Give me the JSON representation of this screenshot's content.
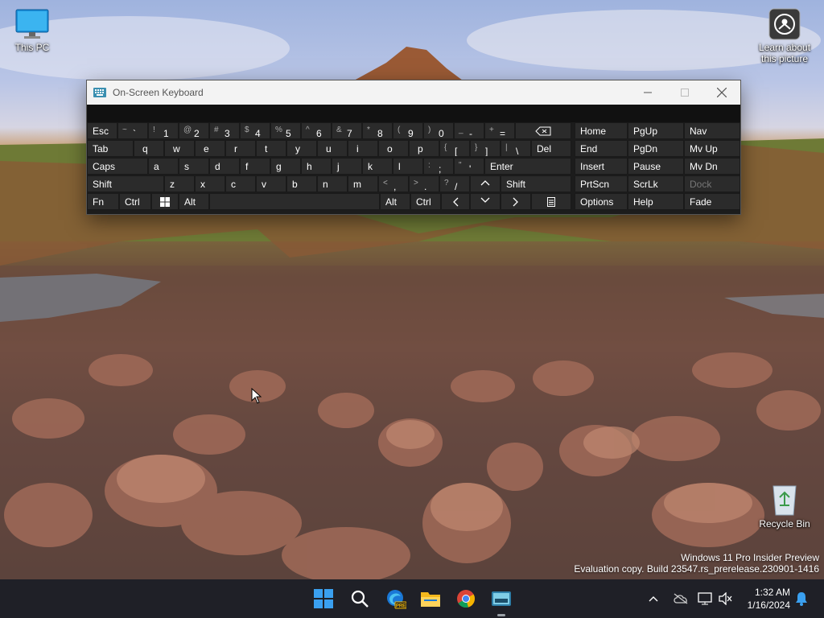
{
  "desktop": {
    "icons": [
      {
        "label": "This PC"
      },
      {
        "label": "Learn about this picture"
      },
      {
        "label": "Recycle Bin"
      }
    ],
    "watermark": {
      "line1": "Windows 11 Pro Insider Preview",
      "line2": "Evaluation copy. Build 23547.rs_prerelease.230901-1416"
    }
  },
  "osk": {
    "title": "On-Screen Keyboard",
    "row1": [
      {
        "label": "Esc"
      },
      {
        "shift": "~",
        "main": "`"
      },
      {
        "shift": "!",
        "main": "1"
      },
      {
        "shift": "@",
        "main": "2"
      },
      {
        "shift": "#",
        "main": "3"
      },
      {
        "shift": "$",
        "main": "4"
      },
      {
        "shift": "%",
        "main": "5"
      },
      {
        "shift": "^",
        "main": "6"
      },
      {
        "shift": "&",
        "main": "7"
      },
      {
        "shift": "*",
        "main": "8"
      },
      {
        "shift": "(",
        "main": "9"
      },
      {
        "shift": ")",
        "main": "0"
      },
      {
        "shift": "_",
        "main": "-"
      },
      {
        "shift": "+",
        "main": "="
      }
    ],
    "row2": {
      "tab": "Tab",
      "letters": [
        "q",
        "w",
        "e",
        "r",
        "t",
        "y",
        "u",
        "i",
        "o",
        "p"
      ],
      "brackets": [
        {
          "shift": "{",
          "main": "["
        },
        {
          "shift": "}",
          "main": "]"
        },
        {
          "shift": "|",
          "main": "\\"
        }
      ],
      "del": "Del"
    },
    "row3": {
      "caps": "Caps",
      "letters": [
        "a",
        "s",
        "d",
        "f",
        "g",
        "h",
        "j",
        "k",
        "l"
      ],
      "punct": [
        {
          "shift": ":",
          "main": ";"
        },
        {
          "shift": "\"",
          "main": "'"
        }
      ],
      "enter": "Enter"
    },
    "row4": {
      "shift_left": "Shift",
      "letters": [
        "z",
        "x",
        "c",
        "v",
        "b",
        "n",
        "m"
      ],
      "punct": [
        {
          "shift": "<",
          "main": ","
        },
        {
          "shift": ">",
          "main": "."
        },
        {
          "shift": "?",
          "main": "/"
        }
      ],
      "shift_right": "Shift"
    },
    "row5": {
      "fn": "Fn",
      "ctrl_left": "Ctrl",
      "alt_left": "Alt",
      "alt_right": "Alt",
      "ctrl_right": "Ctrl"
    },
    "nav": {
      "row1": [
        "Home",
        "PgUp",
        "Nav"
      ],
      "row2": [
        "End",
        "PgDn",
        "Mv Up"
      ],
      "row3": [
        "Insert",
        "Pause",
        "Mv Dn"
      ],
      "row4": [
        "PrtScn",
        "ScrLk",
        "Dock"
      ],
      "row5": [
        "Options",
        "Help",
        "Fade"
      ]
    }
  },
  "taskbar": {
    "time": "1:32 AM",
    "date": "1/16/2024",
    "colors": {
      "accent": "#0078d4",
      "background": "#1f2027"
    }
  }
}
